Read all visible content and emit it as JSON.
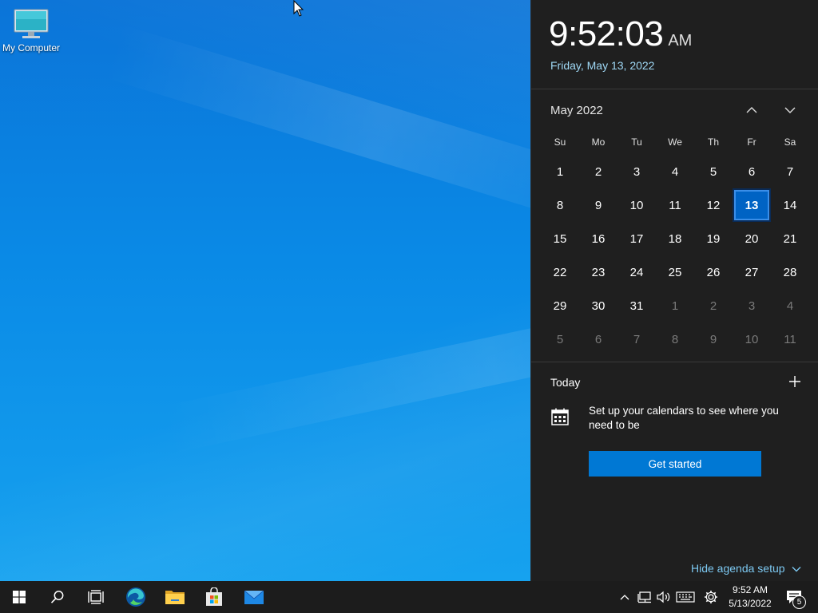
{
  "desktop": {
    "icon_label": "My Computer"
  },
  "flyout": {
    "time": "9:52:03",
    "ampm": "AM",
    "long_date": "Friday, May 13, 2022",
    "month_title": "May 2022",
    "weekdays": [
      "Su",
      "Mo",
      "Tu",
      "We",
      "Th",
      "Fr",
      "Sa"
    ],
    "weeks": [
      [
        "1",
        "2",
        "3",
        "4",
        "5",
        "6",
        "7"
      ],
      [
        "8",
        "9",
        "10",
        "11",
        "12",
        "13",
        "14"
      ],
      [
        "15",
        "16",
        "17",
        "18",
        "19",
        "20",
        "21"
      ],
      [
        "22",
        "23",
        "24",
        "25",
        "26",
        "27",
        "28"
      ],
      [
        "29",
        "30",
        "31",
        "1",
        "2",
        "3",
        "4"
      ],
      [
        "5",
        "6",
        "7",
        "8",
        "9",
        "10",
        "11"
      ]
    ],
    "today_label": "Today",
    "setup_text": "Set up your calendars to see where you need to be",
    "get_started_label": "Get started",
    "hide_agenda_label": "Hide agenda setup",
    "accent_color": "#0078d4"
  },
  "taskbar": {
    "clock_time": "9:52 AM",
    "clock_date": "5/13/2022",
    "notification_count": "5",
    "pinned_apps": [
      "start-icon",
      "search-icon",
      "task-view-icon",
      "edge-icon",
      "file-explorer-icon",
      "store-icon",
      "mail-icon"
    ]
  }
}
